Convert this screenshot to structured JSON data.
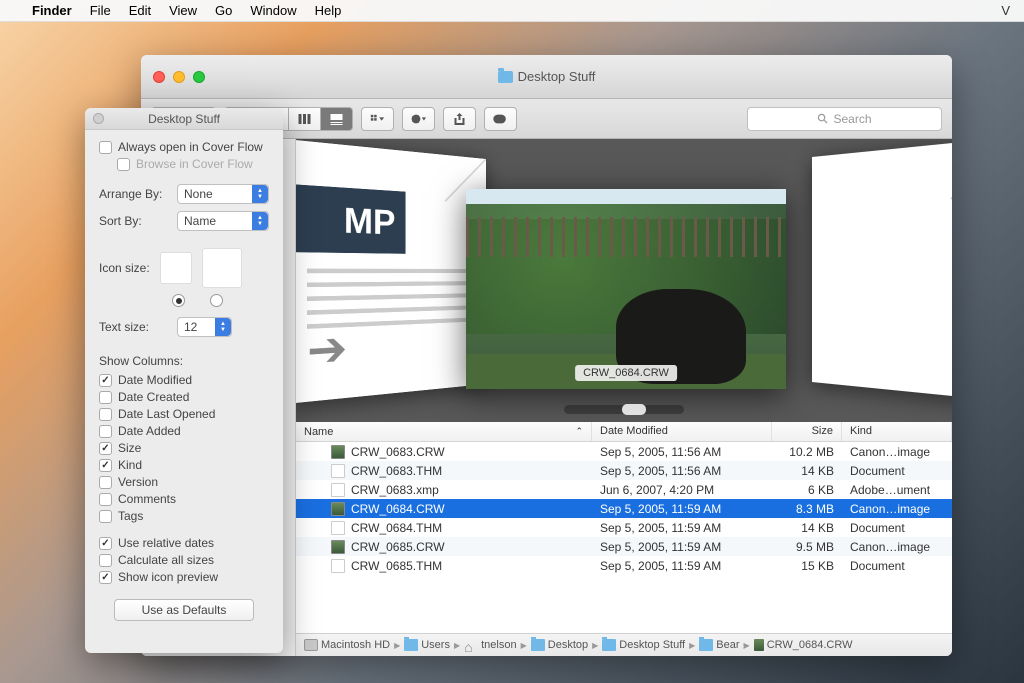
{
  "menubar": {
    "app": "Finder",
    "items": [
      "File",
      "Edit",
      "View",
      "Go",
      "Window",
      "Help"
    ]
  },
  "window": {
    "title": "Desktop Stuff"
  },
  "search": {
    "placeholder": "Search"
  },
  "coverflow": {
    "center_label": "CRW_0684.CRW",
    "left_badge": "MP"
  },
  "columns": {
    "name": "Name",
    "date": "Date Modified",
    "size": "Size",
    "kind": "Kind"
  },
  "files": [
    {
      "name": "CRW_0683.CRW",
      "date": "Sep 5, 2005, 11:56 AM",
      "size": "10.2 MB",
      "kind": "Canon…image",
      "icon": "img",
      "selected": false
    },
    {
      "name": "CRW_0683.THM",
      "date": "Sep 5, 2005, 11:56 AM",
      "size": "14 KB",
      "kind": "Document",
      "icon": "doc",
      "selected": false
    },
    {
      "name": "CRW_0683.xmp",
      "date": "Jun 6, 2007, 4:20 PM",
      "size": "6 KB",
      "kind": "Adobe…ument",
      "icon": "doc",
      "selected": false
    },
    {
      "name": "CRW_0684.CRW",
      "date": "Sep 5, 2005, 11:59 AM",
      "size": "8.3 MB",
      "kind": "Canon…image",
      "icon": "img",
      "selected": true
    },
    {
      "name": "CRW_0684.THM",
      "date": "Sep 5, 2005, 11:59 AM",
      "size": "14 KB",
      "kind": "Document",
      "icon": "doc",
      "selected": false
    },
    {
      "name": "CRW_0685.CRW",
      "date": "Sep 5, 2005, 11:59 AM",
      "size": "9.5 MB",
      "kind": "Canon…image",
      "icon": "img",
      "selected": false
    },
    {
      "name": "CRW_0685.THM",
      "date": "Sep 5, 2005, 11:59 AM",
      "size": "15 KB",
      "kind": "Document",
      "icon": "doc",
      "selected": false
    }
  ],
  "path": [
    "Macintosh HD",
    "Users",
    "tnelson",
    "Desktop",
    "Desktop Stuff",
    "Bear",
    "CRW_0684.CRW"
  ],
  "panel": {
    "title": "Desktop Stuff",
    "always_open": "Always open in Cover Flow",
    "browse": "Browse in Cover Flow",
    "arrange_by_label": "Arrange By:",
    "arrange_by_value": "None",
    "sort_by_label": "Sort By:",
    "sort_by_value": "Name",
    "icon_size_label": "Icon size:",
    "text_size_label": "Text size:",
    "text_size_value": "12",
    "show_columns_label": "Show Columns:",
    "columns": [
      {
        "label": "Date Modified",
        "checked": true
      },
      {
        "label": "Date Created",
        "checked": false
      },
      {
        "label": "Date Last Opened",
        "checked": false
      },
      {
        "label": "Date Added",
        "checked": false
      },
      {
        "label": "Size",
        "checked": true
      },
      {
        "label": "Kind",
        "checked": true
      },
      {
        "label": "Version",
        "checked": false
      },
      {
        "label": "Comments",
        "checked": false
      },
      {
        "label": "Tags",
        "checked": false
      }
    ],
    "relative_dates": {
      "label": "Use relative dates",
      "checked": true
    },
    "calc_sizes": {
      "label": "Calculate all sizes",
      "checked": false
    },
    "icon_preview": {
      "label": "Show icon preview",
      "checked": true
    },
    "defaults_btn": "Use as Defaults"
  }
}
